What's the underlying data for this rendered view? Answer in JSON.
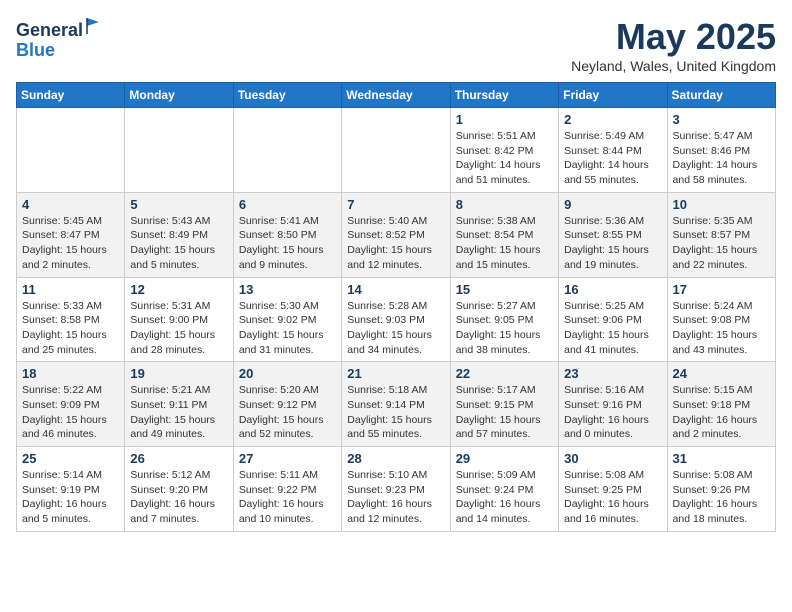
{
  "header": {
    "logo_line1": "General",
    "logo_line2": "Blue",
    "month": "May 2025",
    "location": "Neyland, Wales, United Kingdom"
  },
  "weekdays": [
    "Sunday",
    "Monday",
    "Tuesday",
    "Wednesday",
    "Thursday",
    "Friday",
    "Saturday"
  ],
  "weeks": [
    [
      {
        "day": "",
        "content": ""
      },
      {
        "day": "",
        "content": ""
      },
      {
        "day": "",
        "content": ""
      },
      {
        "day": "",
        "content": ""
      },
      {
        "day": "1",
        "content": "Sunrise: 5:51 AM\nSunset: 8:42 PM\nDaylight: 14 hours\nand 51 minutes."
      },
      {
        "day": "2",
        "content": "Sunrise: 5:49 AM\nSunset: 8:44 PM\nDaylight: 14 hours\nand 55 minutes."
      },
      {
        "day": "3",
        "content": "Sunrise: 5:47 AM\nSunset: 8:46 PM\nDaylight: 14 hours\nand 58 minutes."
      }
    ],
    [
      {
        "day": "4",
        "content": "Sunrise: 5:45 AM\nSunset: 8:47 PM\nDaylight: 15 hours\nand 2 minutes."
      },
      {
        "day": "5",
        "content": "Sunrise: 5:43 AM\nSunset: 8:49 PM\nDaylight: 15 hours\nand 5 minutes."
      },
      {
        "day": "6",
        "content": "Sunrise: 5:41 AM\nSunset: 8:50 PM\nDaylight: 15 hours\nand 9 minutes."
      },
      {
        "day": "7",
        "content": "Sunrise: 5:40 AM\nSunset: 8:52 PM\nDaylight: 15 hours\nand 12 minutes."
      },
      {
        "day": "8",
        "content": "Sunrise: 5:38 AM\nSunset: 8:54 PM\nDaylight: 15 hours\nand 15 minutes."
      },
      {
        "day": "9",
        "content": "Sunrise: 5:36 AM\nSunset: 8:55 PM\nDaylight: 15 hours\nand 19 minutes."
      },
      {
        "day": "10",
        "content": "Sunrise: 5:35 AM\nSunset: 8:57 PM\nDaylight: 15 hours\nand 22 minutes."
      }
    ],
    [
      {
        "day": "11",
        "content": "Sunrise: 5:33 AM\nSunset: 8:58 PM\nDaylight: 15 hours\nand 25 minutes."
      },
      {
        "day": "12",
        "content": "Sunrise: 5:31 AM\nSunset: 9:00 PM\nDaylight: 15 hours\nand 28 minutes."
      },
      {
        "day": "13",
        "content": "Sunrise: 5:30 AM\nSunset: 9:02 PM\nDaylight: 15 hours\nand 31 minutes."
      },
      {
        "day": "14",
        "content": "Sunrise: 5:28 AM\nSunset: 9:03 PM\nDaylight: 15 hours\nand 34 minutes."
      },
      {
        "day": "15",
        "content": "Sunrise: 5:27 AM\nSunset: 9:05 PM\nDaylight: 15 hours\nand 38 minutes."
      },
      {
        "day": "16",
        "content": "Sunrise: 5:25 AM\nSunset: 9:06 PM\nDaylight: 15 hours\nand 41 minutes."
      },
      {
        "day": "17",
        "content": "Sunrise: 5:24 AM\nSunset: 9:08 PM\nDaylight: 15 hours\nand 43 minutes."
      }
    ],
    [
      {
        "day": "18",
        "content": "Sunrise: 5:22 AM\nSunset: 9:09 PM\nDaylight: 15 hours\nand 46 minutes."
      },
      {
        "day": "19",
        "content": "Sunrise: 5:21 AM\nSunset: 9:11 PM\nDaylight: 15 hours\nand 49 minutes."
      },
      {
        "day": "20",
        "content": "Sunrise: 5:20 AM\nSunset: 9:12 PM\nDaylight: 15 hours\nand 52 minutes."
      },
      {
        "day": "21",
        "content": "Sunrise: 5:18 AM\nSunset: 9:14 PM\nDaylight: 15 hours\nand 55 minutes."
      },
      {
        "day": "22",
        "content": "Sunrise: 5:17 AM\nSunset: 9:15 PM\nDaylight: 15 hours\nand 57 minutes."
      },
      {
        "day": "23",
        "content": "Sunrise: 5:16 AM\nSunset: 9:16 PM\nDaylight: 16 hours\nand 0 minutes."
      },
      {
        "day": "24",
        "content": "Sunrise: 5:15 AM\nSunset: 9:18 PM\nDaylight: 16 hours\nand 2 minutes."
      }
    ],
    [
      {
        "day": "25",
        "content": "Sunrise: 5:14 AM\nSunset: 9:19 PM\nDaylight: 16 hours\nand 5 minutes."
      },
      {
        "day": "26",
        "content": "Sunrise: 5:12 AM\nSunset: 9:20 PM\nDaylight: 16 hours\nand 7 minutes."
      },
      {
        "day": "27",
        "content": "Sunrise: 5:11 AM\nSunset: 9:22 PM\nDaylight: 16 hours\nand 10 minutes."
      },
      {
        "day": "28",
        "content": "Sunrise: 5:10 AM\nSunset: 9:23 PM\nDaylight: 16 hours\nand 12 minutes."
      },
      {
        "day": "29",
        "content": "Sunrise: 5:09 AM\nSunset: 9:24 PM\nDaylight: 16 hours\nand 14 minutes."
      },
      {
        "day": "30",
        "content": "Sunrise: 5:08 AM\nSunset: 9:25 PM\nDaylight: 16 hours\nand 16 minutes."
      },
      {
        "day": "31",
        "content": "Sunrise: 5:08 AM\nSunset: 9:26 PM\nDaylight: 16 hours\nand 18 minutes."
      }
    ]
  ]
}
